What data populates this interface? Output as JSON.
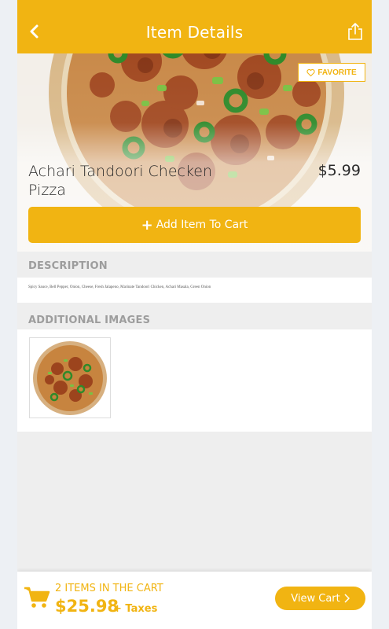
{
  "header": {
    "title": "Item Details",
    "back_icon": "chevron-left-icon",
    "share_icon": "share-icon"
  },
  "item": {
    "name": "Achari Tandoori Checken Pizza",
    "price": "$5.99",
    "favorite_label": "FAVORITE",
    "favorite_icon": "heart-outline-icon",
    "add_to_cart_label": "Add Item To Cart",
    "add_icon": "plus-icon"
  },
  "description": {
    "title": "DESCRIPTION",
    "text": "Spicy Sauce, Bell Pepper, Onion, Cheese, Fresh Jalapeno, Marinate Tandoori Chicken, Achari Masala, Green Onion"
  },
  "additional_images": {
    "title": "ADDITIONAL IMAGES",
    "thumbnail_icon": "pizza-thumbnail"
  },
  "cart": {
    "count_text": "2 ITEMS IN THE CART",
    "total": "$25.98",
    "taxes": "+ Taxes",
    "view_cart_label": "View Cart",
    "cart_icon": "shopping-cart-icon"
  },
  "colors": {
    "accent": "#f1b412",
    "background": "#eeeeee",
    "section_title": "#9d9d9d"
  }
}
